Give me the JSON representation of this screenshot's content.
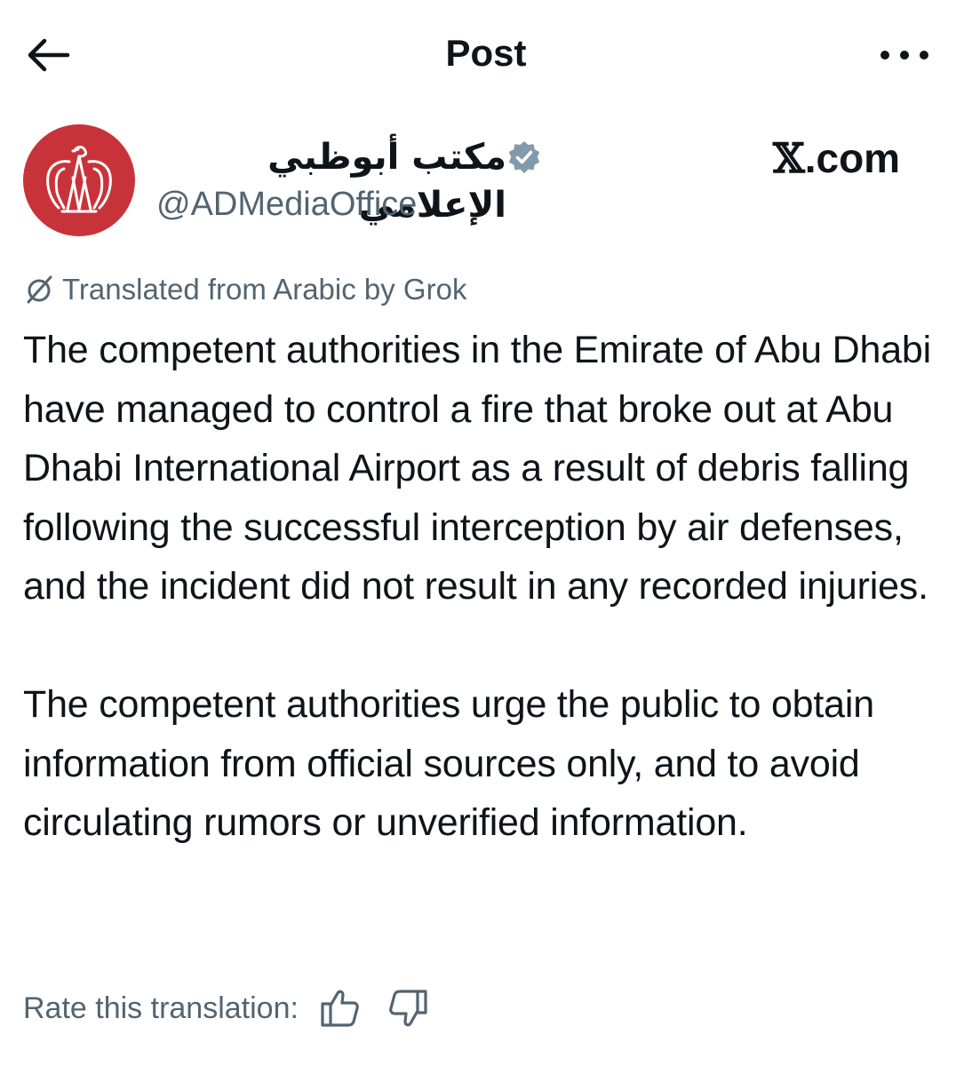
{
  "header": {
    "title": "Post",
    "back_icon": "arrow-left-icon",
    "more_icon": "more-horizontal-icon"
  },
  "author": {
    "name": "مكتب أبوظبي الإعلامي",
    "handle": "@ADMediaOffice",
    "verified": true,
    "avatar_color": "#c8333a"
  },
  "brand": {
    "x": "𝕏",
    "domain": ".com"
  },
  "translation": {
    "note": "Translated from Arabic by Grok",
    "icon": "grok-icon"
  },
  "body": {
    "paragraph_1": "The competent authorities in the Emirate of Abu Dhabi have managed to control a fire that broke out at Abu Dhabi International Airport as a result of debris falling following the successful interception by air defenses, and the incident did not result in any recorded injuries.",
    "paragraph_2": "The competent authorities urge the public to obtain information from official sources only, and to avoid circulating rumors or unverified information."
  },
  "rating": {
    "label": "Rate this translation:",
    "thumbs_up_icon": "thumbs-up-icon",
    "thumbs_down_icon": "thumbs-down-icon"
  }
}
